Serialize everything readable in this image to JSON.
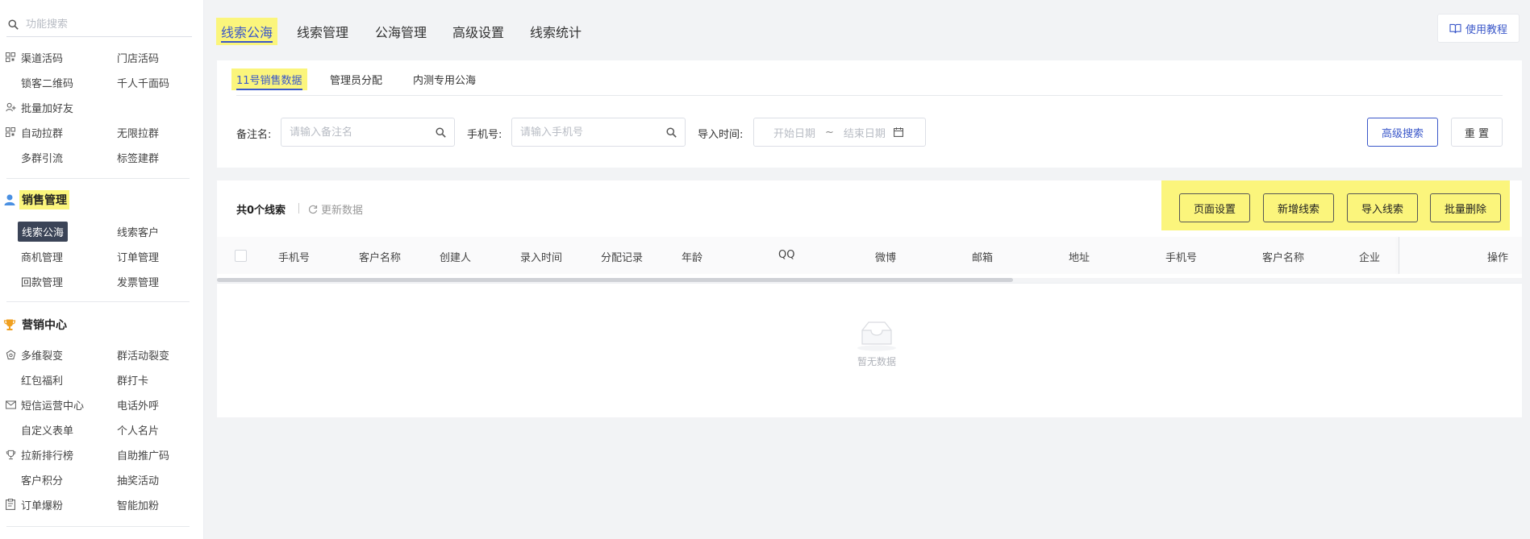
{
  "sidebar": {
    "search_placeholder": "功能搜索",
    "group1": [
      {
        "icon": "qrcode-icon",
        "c1": "渠道活码",
        "c2": "门店活码"
      },
      {
        "icon": "",
        "c1": "锁客二维码",
        "c2": "千人千面码"
      },
      {
        "icon": "add-friend-icon",
        "c1": "批量加好友",
        "c2": ""
      },
      {
        "icon": "qrcode-icon",
        "c1": "自动拉群",
        "c2": "无限拉群"
      },
      {
        "icon": "",
        "c1": "多群引流",
        "c2": "标签建群"
      }
    ],
    "sales_title": "销售管理",
    "sales": [
      {
        "c1": "线索公海",
        "c2": "线索客户"
      },
      {
        "c1": "商机管理",
        "c2": "订单管理"
      },
      {
        "c1": "回款管理",
        "c2": "发票管理"
      }
    ],
    "marketing_title": "营销中心",
    "marketing": [
      {
        "icon": "gift-icon",
        "c1": "多维裂变",
        "c2": "群活动裂变"
      },
      {
        "icon": "",
        "c1": "红包福利",
        "c2": "群打卡"
      },
      {
        "icon": "mail-icon",
        "c1": "短信运营中心",
        "c2": "电话外呼"
      },
      {
        "icon": "",
        "c1": "自定义表单",
        "c2": "个人名片"
      },
      {
        "icon": "trophy-icon",
        "c1": "拉新排行榜",
        "c2": "自助推广码"
      },
      {
        "icon": "",
        "c1": "客户积分",
        "c2": "抽奖活动"
      },
      {
        "icon": "clipboard-icon",
        "c1": "订单爆粉",
        "c2": "智能加粉"
      }
    ]
  },
  "topnav": {
    "tabs": [
      "线索公海",
      "线索管理",
      "公海管理",
      "高级设置",
      "线索统计"
    ],
    "tutorial_label": "使用教程"
  },
  "filter": {
    "subtabs": [
      "11号销售数据",
      "管理员分配",
      "内测专用公海"
    ],
    "remark_label": "备注名:",
    "remark_placeholder": "请输入备注名",
    "phone_label": "手机号:",
    "phone_placeholder": "请输入手机号",
    "import_time_label": "导入时间:",
    "start_date": "开始日期",
    "date_sep": "~",
    "end_date": "结束日期",
    "advanced_search": "高级搜索",
    "reset": "重 置"
  },
  "table": {
    "summary": "共0个线索",
    "refresh": "更新数据",
    "actions": [
      "页面设置",
      "新增线索",
      "导入线索",
      "批量删除"
    ],
    "columns": [
      "手机号",
      "客户名称",
      "创建人",
      "录入时间",
      "分配记录",
      "年龄",
      "QQ",
      "微博",
      "邮箱",
      "地址",
      "手机号",
      "客户名称",
      "企业"
    ],
    "op_column": "操作",
    "empty_text": "暂无数据"
  },
  "colors": {
    "accent": "#3a57c9",
    "highlight": "#fbf57c",
    "active_menu_bg": "#3b4457"
  }
}
